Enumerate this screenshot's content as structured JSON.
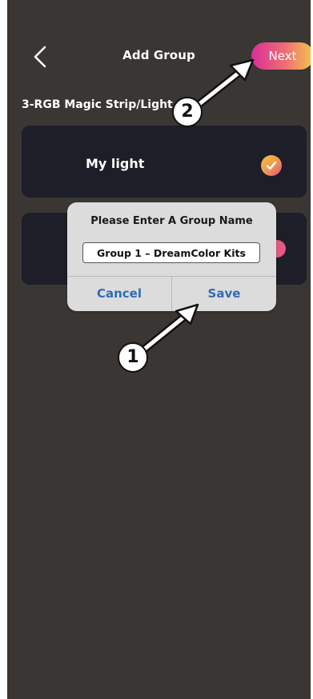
{
  "header": {
    "title": "Add Group",
    "next_label": "Next"
  },
  "section": {
    "label": "3-RGB Magic Strip/Light"
  },
  "devices": [
    {
      "label": "My light",
      "checked": true
    },
    {
      "label": "",
      "checked": true
    }
  ],
  "dialog": {
    "title": "Please Enter A Group Name",
    "input_value": "Group 1 – DreamColor Kits",
    "cancel_label": "Cancel",
    "save_label": "Save"
  },
  "annotations": {
    "step_1": "1",
    "step_2": "2"
  },
  "colors": {
    "background": "#3a3634",
    "card": "#1d1e27",
    "accent_blue": "#2f6db5",
    "gradient_pink": "#d92e98",
    "gradient_yellow": "#f2c84b"
  },
  "icons": {
    "back": "chevron-left-icon",
    "check": "checkmark-icon",
    "arrow": "arrow-icon"
  }
}
